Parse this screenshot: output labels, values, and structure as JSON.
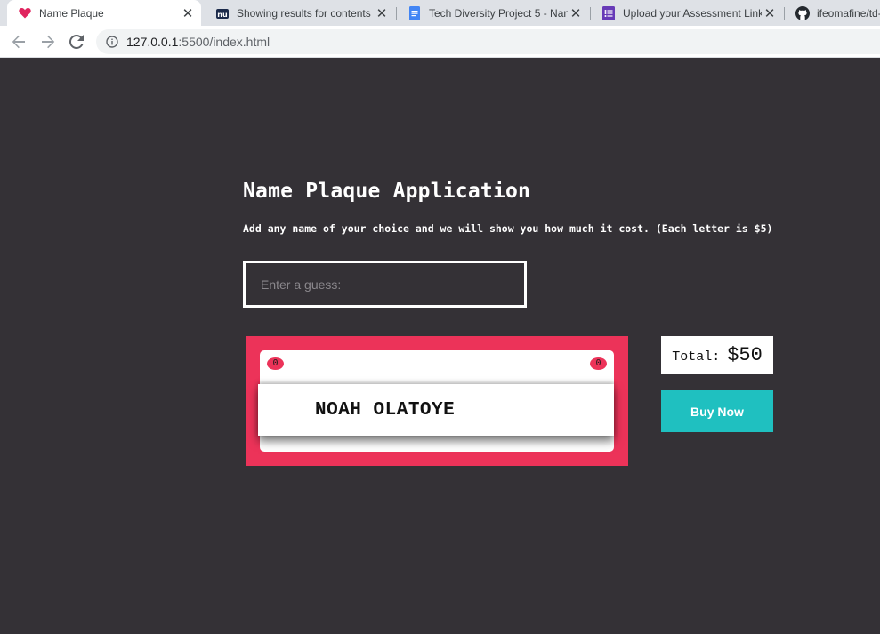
{
  "browser": {
    "tabs": [
      {
        "title": "Name Plaque",
        "icon": "heart-icon",
        "active": true
      },
      {
        "title": "Showing results for contents",
        "icon": "site-logo-icon",
        "active": false
      },
      {
        "title": "Tech Diversity Project 5 - Nan",
        "icon": "docs-icon",
        "active": false
      },
      {
        "title": "Upload your Assessment Link",
        "icon": "forms-icon",
        "active": false
      },
      {
        "title": "ifeomafine/td-",
        "icon": "github-icon",
        "active": false
      }
    ],
    "url_host": "127.0.0.1",
    "url_path": ":5500/index.html"
  },
  "app": {
    "heading": "Name Plaque Application",
    "subtitle": "Add any name of your choice and we will show you how much it cost. (Each letter is $5)",
    "input": {
      "placeholder": "Enter a guess:",
      "value": ""
    },
    "plaque": {
      "screw_left": "0",
      "screw_right": "0",
      "name": "NOAH OLATOYE"
    },
    "total_label": "Total:",
    "total_value": "$50",
    "buy_label": "Buy Now"
  },
  "colors": {
    "page_bg": "#343136",
    "plaque_frame": "#ec3359",
    "buy_button": "#1fc0c0"
  }
}
